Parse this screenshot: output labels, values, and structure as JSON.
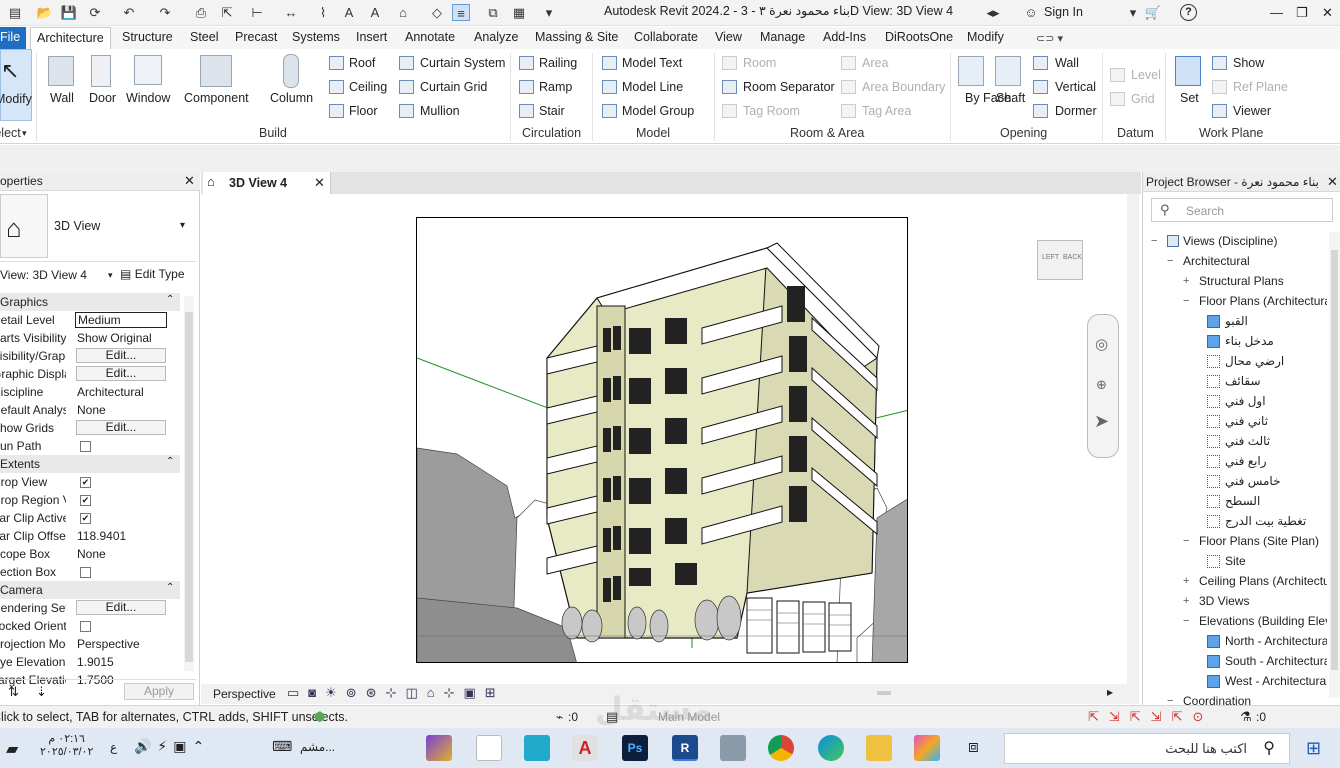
{
  "titlebar": {
    "title": "Autodesk Revit 2024.2 - بناء محمود نعرة ٣ - 3D View: 3D View 4",
    "sign_in": "Sign In",
    "help_icon": "?",
    "minimize": "—",
    "restore": "❐",
    "close": "✕"
  },
  "tabs": [
    "File",
    "Architecture",
    "Structure",
    "Steel",
    "Precast",
    "Systems",
    "Insert",
    "Annotate",
    "Analyze",
    "Massing & Site",
    "Collaborate",
    "View",
    "Manage",
    "Add-Ins",
    "DiRootsOne",
    "Modify"
  ],
  "ribbon": {
    "select": {
      "modify": "Modify",
      "label": "Select"
    },
    "build": {
      "wall": "Wall",
      "door": "Door",
      "window": "Window",
      "component": "Component",
      "column": "Column",
      "roof": "Roof",
      "ceiling": "Ceiling",
      "floor": "Floor",
      "curtain_system": "Curtain System",
      "curtain_grid": "Curtain Grid",
      "mullion": "Mullion",
      "label": "Build"
    },
    "circulation": {
      "railing": "Railing",
      "ramp": "Ramp",
      "stair": "Stair",
      "label": "Circulation"
    },
    "model": {
      "model_text": "Model Text",
      "model_line": "Model Line",
      "model_group": "Model Group",
      "label": "Model"
    },
    "room_area": {
      "room": "Room",
      "room_separator": "Room Separator",
      "tag_room": "Tag Room",
      "area": "Area",
      "area_boundary": "Area Boundary",
      "tag_area": "Tag Area",
      "label": "Room & Area"
    },
    "opening": {
      "by_face": "By Face",
      "shaft": "Shaft",
      "wall": "Wall",
      "vertical": "Vertical",
      "dormer": "Dormer",
      "label": "Opening"
    },
    "datum": {
      "level": "Level",
      "grid": "Grid",
      "label": "Datum"
    },
    "work_plane": {
      "set": "Set",
      "show": "Show",
      "ref_plane": "Ref Plane",
      "viewer": "Viewer",
      "label": "Work Plane"
    }
  },
  "properties": {
    "title": "Properties",
    "type": "3D View",
    "selector": "View: 3D View 4",
    "edit_type": "Edit Type",
    "rows": [
      {
        "kind": "section",
        "label": "Graphics"
      },
      {
        "kind": "input",
        "key": "Detail Level",
        "value": "Medium"
      },
      {
        "kind": "text",
        "key": "Parts Visibility",
        "value": "Show Original"
      },
      {
        "kind": "button",
        "key": "Visibility/Graphics",
        "value": "Edit..."
      },
      {
        "kind": "button",
        "key": "Graphic Display",
        "value": "Edit..."
      },
      {
        "kind": "text",
        "key": "Discipline",
        "value": "Architectural"
      },
      {
        "kind": "text",
        "key": "Default Analysis",
        "value": "None"
      },
      {
        "kind": "button",
        "key": "Show Grids",
        "value": "Edit..."
      },
      {
        "kind": "check",
        "key": "Sun Path",
        "value": ""
      },
      {
        "kind": "section",
        "label": "Extents"
      },
      {
        "kind": "check",
        "key": "Crop View",
        "value": "✔"
      },
      {
        "kind": "check",
        "key": "Crop Region Visible",
        "value": "✔"
      },
      {
        "kind": "check",
        "key": "Far Clip Active",
        "value": "✔"
      },
      {
        "kind": "text",
        "key": "Far Clip Offset",
        "value": "118.9401"
      },
      {
        "kind": "text",
        "key": "Scope Box",
        "value": "None"
      },
      {
        "kind": "check",
        "key": "Section Box",
        "value": ""
      },
      {
        "kind": "section",
        "label": "Camera"
      },
      {
        "kind": "button",
        "key": "Rendering Settings",
        "value": "Edit..."
      },
      {
        "kind": "check",
        "key": "Locked Orientation",
        "value": ""
      },
      {
        "kind": "text",
        "key": "Projection Mode",
        "value": "Perspective"
      },
      {
        "kind": "text",
        "key": "Eye Elevation",
        "value": "1.9015"
      },
      {
        "kind": "text",
        "key": "Target Elevation",
        "value": "1.7500"
      }
    ],
    "apply": "Apply"
  },
  "view": {
    "tab": "3D View 4",
    "viewcube_left": "LEFT",
    "viewcube_back": "BACK",
    "mode": "Perspective"
  },
  "browser": {
    "title": "Project Browser - بناء محمود نعرة",
    "search_placeholder": "Search",
    "items": [
      {
        "level": 0,
        "toggle": "−",
        "label": "Views (Discipline)",
        "box": "none"
      },
      {
        "level": 1,
        "toggle": "−",
        "label": "Architectural",
        "box": "none"
      },
      {
        "level": 2,
        "toggle": "+",
        "label": "Structural Plans",
        "box": "none"
      },
      {
        "level": 2,
        "toggle": "−",
        "label": "Floor Plans (Architectural)",
        "box": "none"
      },
      {
        "level": 3,
        "toggle": "",
        "label": "القبو",
        "box": "blue"
      },
      {
        "level": 3,
        "toggle": "",
        "label": "مدخل بناء",
        "box": "blue"
      },
      {
        "level": 3,
        "toggle": "",
        "label": "ارضي محال",
        "box": "dot"
      },
      {
        "level": 3,
        "toggle": "",
        "label": "سقائف",
        "box": "dot"
      },
      {
        "level": 3,
        "toggle": "",
        "label": "اول فني",
        "box": "dot"
      },
      {
        "level": 3,
        "toggle": "",
        "label": "ثاني فني",
        "box": "dot"
      },
      {
        "level": 3,
        "toggle": "",
        "label": "ثالث فني",
        "box": "dot"
      },
      {
        "level": 3,
        "toggle": "",
        "label": "رابع فني",
        "box": "dot"
      },
      {
        "level": 3,
        "toggle": "",
        "label": "خامس فني",
        "box": "dot"
      },
      {
        "level": 3,
        "toggle": "",
        "label": "السطح",
        "box": "dot"
      },
      {
        "level": 3,
        "toggle": "",
        "label": "تغطية بيت الدرج",
        "box": "dot"
      },
      {
        "level": 2,
        "toggle": "−",
        "label": "Floor Plans (Site Plan)",
        "box": "none"
      },
      {
        "level": 3,
        "toggle": "",
        "label": "Site",
        "box": "dot"
      },
      {
        "level": 2,
        "toggle": "+",
        "label": "Ceiling Plans (Architectural)",
        "box": "none"
      },
      {
        "level": 2,
        "toggle": "+",
        "label": "3D Views",
        "box": "none"
      },
      {
        "level": 2,
        "toggle": "−",
        "label": "Elevations (Building Elevation)",
        "box": "none"
      },
      {
        "level": 3,
        "toggle": "",
        "label": "North - Architectural",
        "box": "blue"
      },
      {
        "level": 3,
        "toggle": "",
        "label": "South - Architectural",
        "box": "blue"
      },
      {
        "level": 3,
        "toggle": "",
        "label": "West - Architectural",
        "box": "blue"
      },
      {
        "level": 1,
        "toggle": "−",
        "label": "Coordination",
        "box": "none"
      }
    ]
  },
  "status": {
    "message": "Click to select, TAB for alternates, CTRL adds, SHIFT unselects.",
    "coord": ":0",
    "model": "Main Model",
    "filter": ":0",
    "watermark": "مستقل"
  },
  "taskbar": {
    "time": "٠٢:١٦ م",
    "date": "٢٠٢٥/٠٣/٠٢",
    "lang": "ع",
    "search_placeholder": "اكتب هنا للبحث",
    "pinned_label": "مشم..."
  }
}
